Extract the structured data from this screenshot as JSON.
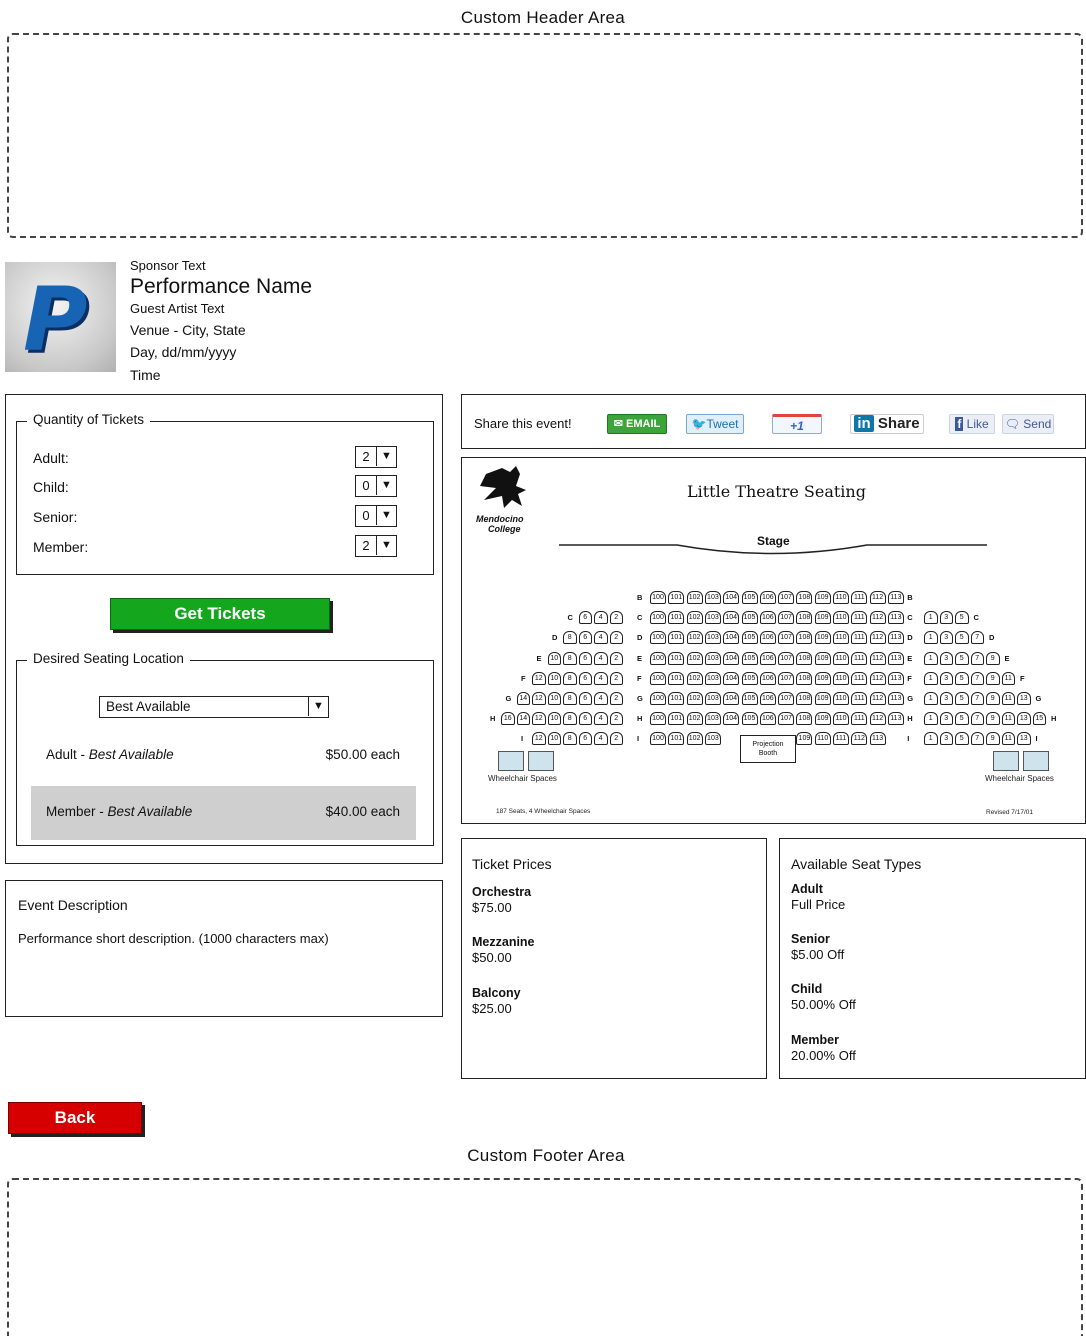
{
  "header": {
    "label": "Custom Header Area"
  },
  "footer": {
    "label": "Custom Footer Area"
  },
  "performance": {
    "logo_letter": "P",
    "sponsor": "Sponsor Text",
    "name": "Performance Name",
    "guest_artist": "Guest Artist Text",
    "venue": "Venue - City, State",
    "date": "Day, dd/mm/yyyy",
    "time": "Time"
  },
  "quantity": {
    "legend": "Quantity of Tickets",
    "rows": [
      {
        "label": "Adult:",
        "value": "2"
      },
      {
        "label": "Child:",
        "value": "0"
      },
      {
        "label": "Senior:",
        "value": "0"
      },
      {
        "label": "Member:",
        "value": "2"
      }
    ]
  },
  "get_tickets_label": "Get Tickets",
  "seating": {
    "legend": "Desired Seating Location",
    "selected": "Best Available",
    "prices": [
      {
        "type": "Adult",
        "location": "Best Available",
        "price": "$50.00 each"
      },
      {
        "type": "Member",
        "location": "Best Available",
        "price": "$40.00 each"
      }
    ],
    "separator": " - "
  },
  "event": {
    "title": "Event Description",
    "description": "Performance short description. (1000 characters max)"
  },
  "back_label": "Back",
  "share": {
    "label": "Share this event!",
    "email": "EMAIL",
    "tweet": "Tweet",
    "plus_one": "+1",
    "linkedin_in": "in",
    "linkedin_share": "Share",
    "like": "Like",
    "send": "Send"
  },
  "chart": {
    "title": "Little Theatre Seating",
    "college_line1": "Mendocino",
    "college_line2": "College",
    "stage": "Stage",
    "booth_line1": "Projection",
    "booth_line2": "Booth",
    "wheelchair_left": "Wheelchair Spaces",
    "wheelchair_right": "Wheelchair Spaces",
    "capacity": "187 Seats, 4 Wheelchair Spaces",
    "revised": "Revised 7/17/01",
    "rows": [
      {
        "row": "B",
        "left": [],
        "center": [
          "100",
          "101",
          "102",
          "103",
          "104",
          "105",
          "106",
          "107",
          "108",
          "109",
          "110",
          "111",
          "112",
          "113"
        ],
        "right": []
      },
      {
        "row": "C",
        "left": [
          "6",
          "4",
          "2"
        ],
        "center": [
          "100",
          "101",
          "102",
          "103",
          "104",
          "105",
          "106",
          "107",
          "108",
          "109",
          "110",
          "111",
          "112",
          "113"
        ],
        "right": [
          "1",
          "3",
          "5"
        ]
      },
      {
        "row": "D",
        "left": [
          "8",
          "6",
          "4",
          "2"
        ],
        "center": [
          "100",
          "101",
          "102",
          "103",
          "104",
          "105",
          "106",
          "107",
          "108",
          "109",
          "110",
          "111",
          "112",
          "113"
        ],
        "right": [
          "1",
          "3",
          "5",
          "7"
        ]
      },
      {
        "row": "E",
        "left": [
          "10",
          "8",
          "6",
          "4",
          "2"
        ],
        "center": [
          "100",
          "101",
          "102",
          "103",
          "104",
          "105",
          "106",
          "107",
          "108",
          "109",
          "110",
          "111",
          "112",
          "113"
        ],
        "right": [
          "1",
          "3",
          "5",
          "7",
          "9"
        ]
      },
      {
        "row": "F",
        "left": [
          "12",
          "10",
          "8",
          "6",
          "4",
          "2"
        ],
        "center": [
          "100",
          "101",
          "102",
          "103",
          "104",
          "105",
          "106",
          "107",
          "108",
          "109",
          "110",
          "111",
          "112",
          "113"
        ],
        "right": [
          "1",
          "3",
          "5",
          "7",
          "9",
          "11"
        ]
      },
      {
        "row": "G",
        "left": [
          "14",
          "12",
          "10",
          "8",
          "6",
          "4",
          "2"
        ],
        "center": [
          "100",
          "101",
          "102",
          "103",
          "104",
          "105",
          "106",
          "107",
          "108",
          "109",
          "110",
          "111",
          "112",
          "113"
        ],
        "right": [
          "1",
          "3",
          "5",
          "7",
          "9",
          "11",
          "13"
        ]
      },
      {
        "row": "H",
        "left": [
          "16",
          "14",
          "12",
          "10",
          "8",
          "6",
          "4",
          "2"
        ],
        "center": [
          "100",
          "101",
          "102",
          "103",
          "104",
          "105",
          "106",
          "107",
          "108",
          "109",
          "110",
          "111",
          "112",
          "113"
        ],
        "right": [
          "1",
          "3",
          "5",
          "7",
          "9",
          "11",
          "13",
          "15"
        ]
      },
      {
        "row": "I",
        "left": [
          "12",
          "10",
          "8",
          "6",
          "4",
          "2"
        ],
        "center": [
          "100",
          "101",
          "102",
          "103",
          "",
          "",
          "",
          "",
          "109",
          "110",
          "111",
          "112",
          "113"
        ],
        "right": [
          "1",
          "3",
          "5",
          "7",
          "9",
          "11",
          "13"
        ]
      }
    ]
  },
  "ticket_prices": {
    "title": "Ticket Prices",
    "items": [
      {
        "name": "Orchestra",
        "price": "$75.00"
      },
      {
        "name": "Mezzanine",
        "price": "$50.00"
      },
      {
        "name": "Balcony",
        "price": "$25.00"
      }
    ]
  },
  "seat_types": {
    "title": "Available Seat Types",
    "items": [
      {
        "name": "Adult",
        "detail": "Full Price"
      },
      {
        "name": "Senior",
        "detail": "$5.00 Off"
      },
      {
        "name": "Child",
        "detail": "50.00% Off"
      },
      {
        "name": "Member",
        "detail": "20.00% Off"
      }
    ]
  }
}
